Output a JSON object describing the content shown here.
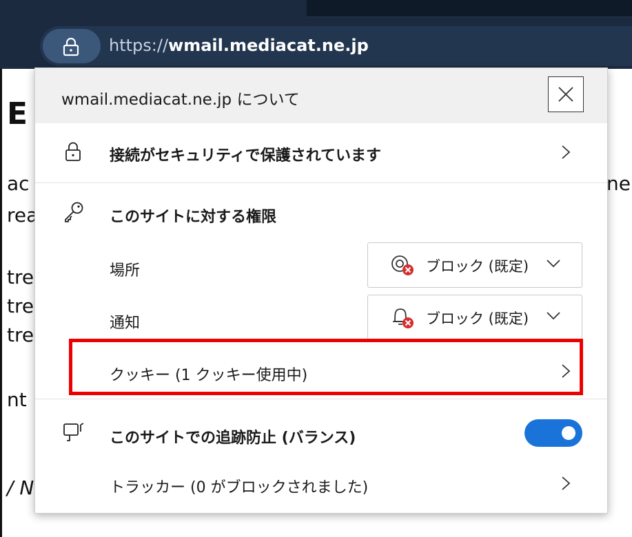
{
  "address_bar": {
    "url_scheme": "https://",
    "url_host": "wmail.mediacat.ne.jp"
  },
  "background_page": {
    "heading_fragment": "E",
    "fragments_left": [
      "ac",
      "rea",
      "tre",
      "tre",
      "tre",
      "nt",
      "/ N"
    ],
    "fragment_right": "ne"
  },
  "popup": {
    "title": "wmail.mediacat.ne.jp について",
    "connection": {
      "label": "接続がセキュリティで保護されています"
    },
    "permissions": {
      "heading": "このサイトに対する権限",
      "location": {
        "label": "場所",
        "value": "ブロック (既定)"
      },
      "notifications": {
        "label": "通知",
        "value": "ブロック (既定)"
      }
    },
    "cookies": {
      "label": "クッキー (1 クッキー使用中)"
    },
    "tracking": {
      "label": "このサイトでの追跡防止 (バランス)",
      "toggle_on": true
    },
    "trackers": {
      "label": "トラッカー (0 がブロックされました)"
    }
  },
  "colors": {
    "highlight": "#ee0000",
    "toggle": "#1a73d9",
    "blocked_badge": "#d32f2f"
  }
}
